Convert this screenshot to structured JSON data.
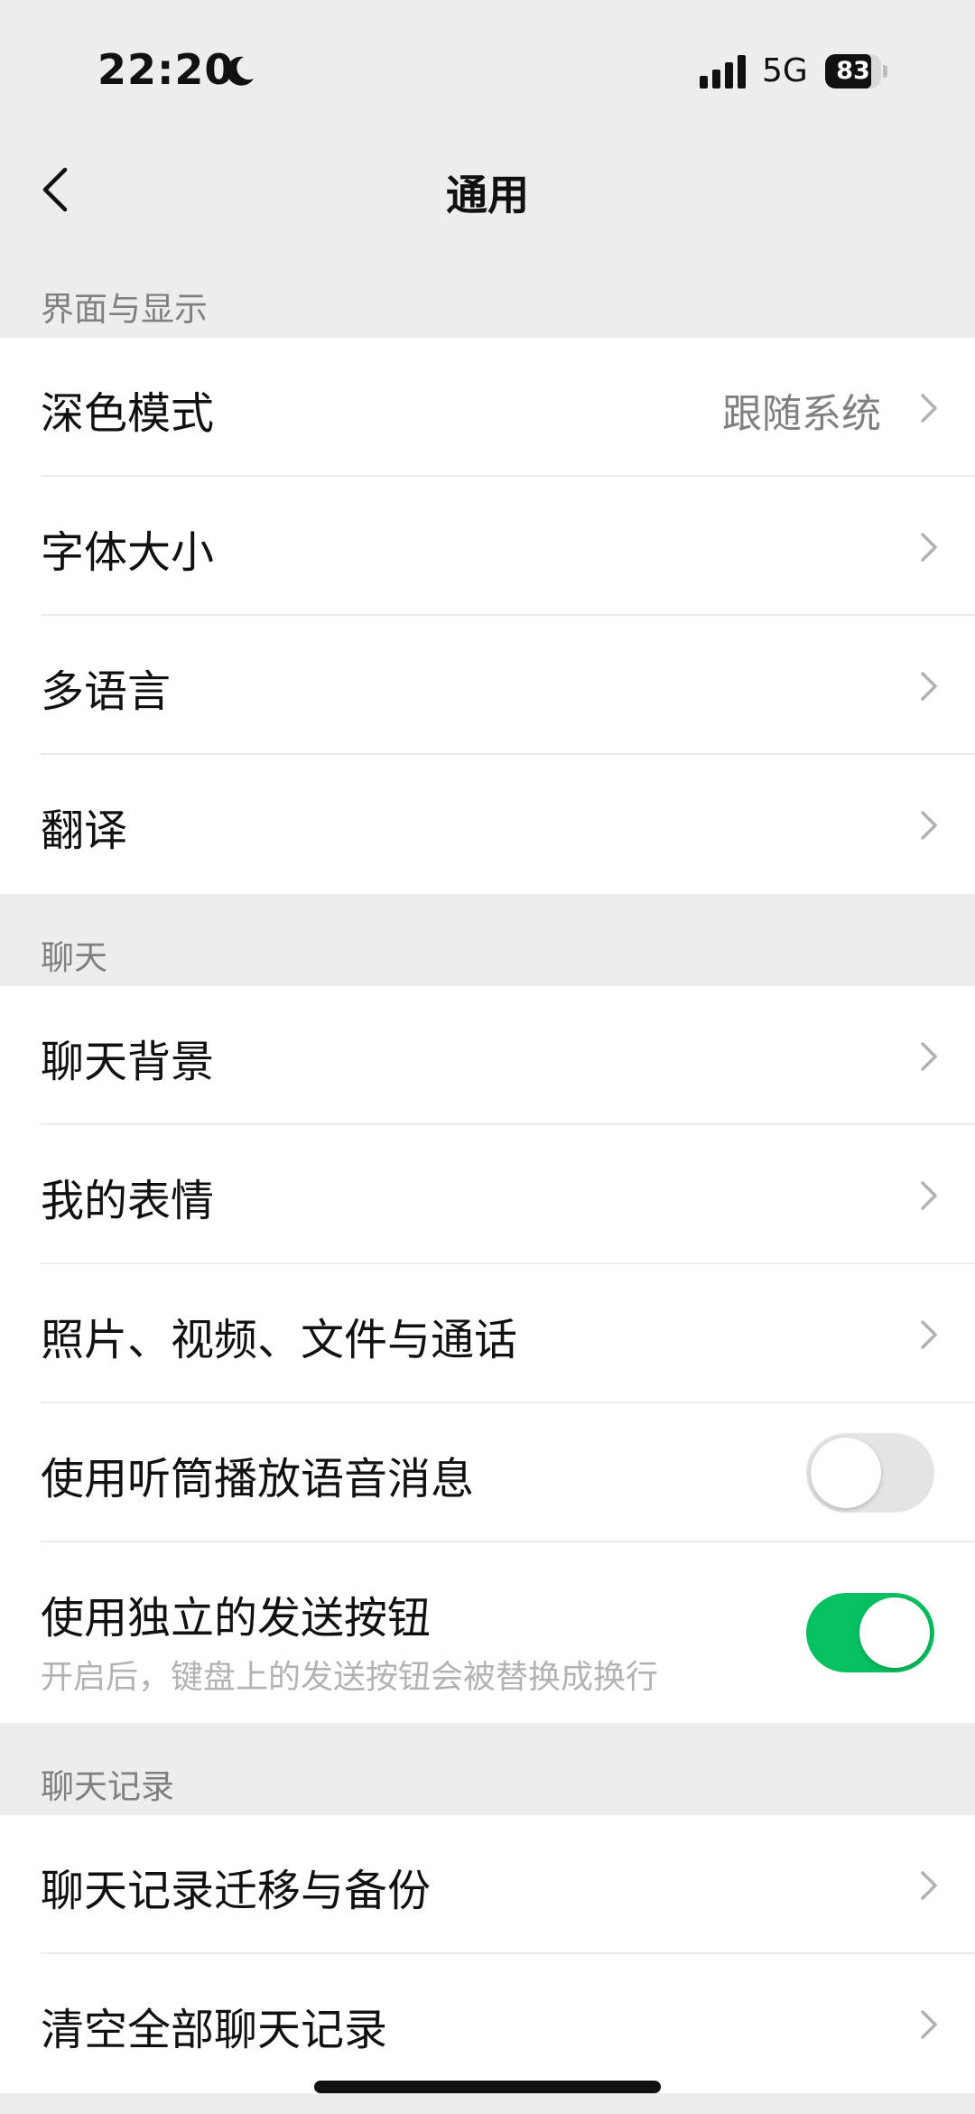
{
  "status_bar": {
    "time": "22:20",
    "network": "5G",
    "battery": "83",
    "battery_level": 0.83
  },
  "nav": {
    "title": "通用"
  },
  "sections": {
    "display": {
      "header": "界面与显示",
      "dark_mode": {
        "label": "深色模式",
        "value": "跟随系统"
      },
      "font_size": {
        "label": "字体大小"
      },
      "language": {
        "label": "多语言"
      },
      "translate": {
        "label": "翻译"
      }
    },
    "chat": {
      "header": "聊天",
      "background": {
        "label": "聊天背景"
      },
      "stickers": {
        "label": "我的表情"
      },
      "media": {
        "label": "照片、视频、文件与通话"
      },
      "earpiece": {
        "label": "使用听筒播放语音消息",
        "enabled": false
      },
      "send_button": {
        "label": "使用独立的发送按钮",
        "description": "开启后，键盘上的发送按钮会被替换成换行",
        "enabled": true
      }
    },
    "history": {
      "header": "聊天记录",
      "migrate": {
        "label": "聊天记录迁移与备份"
      },
      "clear": {
        "label": "清空全部聊天记录"
      }
    }
  },
  "colors": {
    "accent": "#07c160",
    "background": "#ededed",
    "secondary_text": "#808080"
  },
  "icons": [
    "moon-icon",
    "signal-icon",
    "battery-icon",
    "back-arrow-icon",
    "chevron-right-icon"
  ]
}
